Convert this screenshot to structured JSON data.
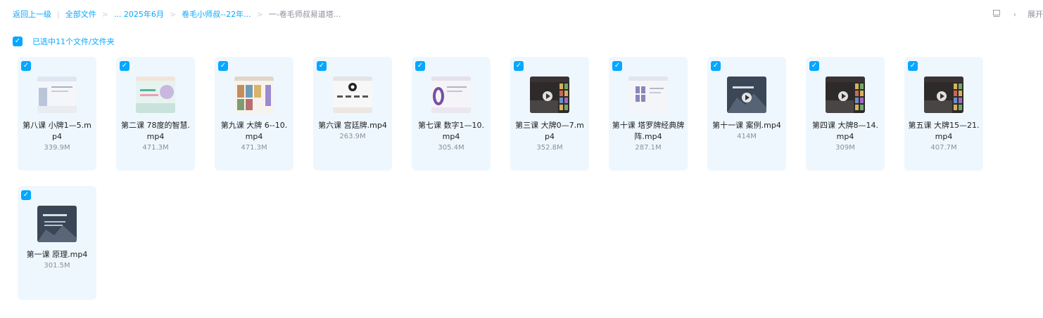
{
  "breadcrumb": {
    "back": "返回上一级",
    "all_files": "全部文件",
    "level1": "... 2025年6月",
    "level2": "卷毛小师叔--22年...",
    "current": "一-卷毛师叔易道塔..."
  },
  "toolbar": {
    "expand_label": "展开"
  },
  "selection": {
    "label": "已选中11个文件/文件夹"
  },
  "files": [
    {
      "name": "第八课 小牌1—5.mp4",
      "size": "339.9M",
      "thumb": "slide"
    },
    {
      "name": "第二课 78度的智慧.mp4",
      "size": "471.3M",
      "thumb": "pastel"
    },
    {
      "name": "第九课 大牌 6--10.mp4",
      "size": "471.3M",
      "thumb": "cards"
    },
    {
      "name": "第六课 宫廷牌.mp4",
      "size": "263.9M",
      "thumb": "diagram"
    },
    {
      "name": "第七课 数字1—10.mp4",
      "size": "305.4M",
      "thumb": "zero"
    },
    {
      "name": "第三课 大牌0—7.mp4",
      "size": "352.8M",
      "thumb": "dark"
    },
    {
      "name": "第十课 塔罗牌经典牌阵.mp4",
      "size": "287.1M",
      "thumb": "spread"
    },
    {
      "name": "第十一课 案例.mp4",
      "size": "414M",
      "thumb": "mountain"
    },
    {
      "name": "第四课 大牌8—14.mp4",
      "size": "309M",
      "thumb": "dark"
    },
    {
      "name": "第五课 大牌15—21.mp4",
      "size": "407.7M",
      "thumb": "dark"
    },
    {
      "name": "第一课 原理.mp4",
      "size": "301.5M",
      "thumb": "mountain2"
    }
  ]
}
